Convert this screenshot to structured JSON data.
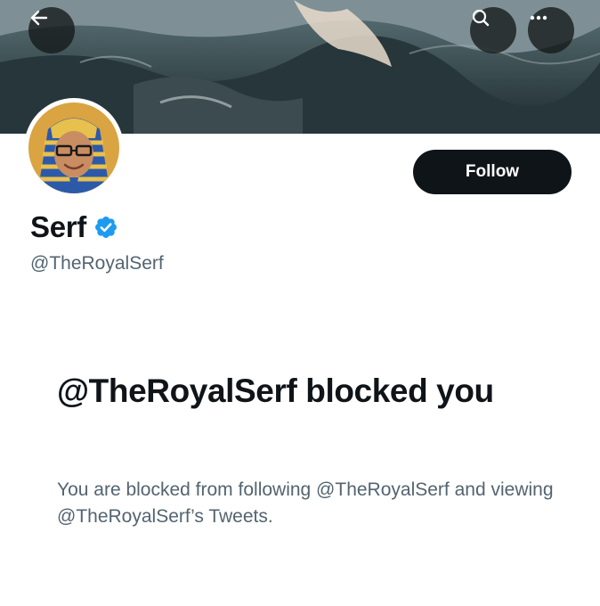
{
  "header": {
    "back_icon": "arrow-left-icon",
    "search_icon": "search-icon",
    "more_icon": "more-horizontal-icon"
  },
  "profile": {
    "display_name": "Serf",
    "handle": "@TheRoyalSerf",
    "verified": true,
    "verified_color": "#1d9bf0",
    "follow_label": "Follow"
  },
  "blocked": {
    "title": "@TheRoyalSerf blocked you",
    "description": "You are blocked from following @TheRoyalSerf and viewing @TheRoyalSerf’s Tweets."
  },
  "colors": {
    "primary_text": "#0f1419",
    "secondary_text": "#536471",
    "button_dark": "#0f1419"
  }
}
